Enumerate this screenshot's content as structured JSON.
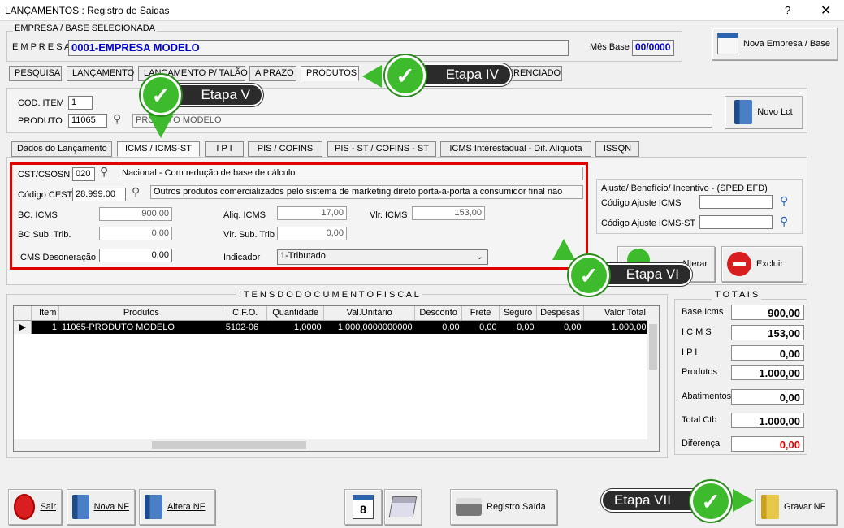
{
  "window": {
    "title": "LANÇAMENTOS : Registro de Saidas",
    "help": "?",
    "close": "✕"
  },
  "empresa": {
    "section_label": "EMPRESA / BASE SELECIONADA",
    "label": "E M P R E S A",
    "value": "0001-EMPRESA MODELO",
    "mes_base_label": "Mês Base",
    "mes_base_value": "00/0000",
    "nova_button": "Nova Empresa / Base"
  },
  "top_tabs": [
    "PESQUISA",
    "LANÇAMENTO",
    "LANÇAMENTO P/ TALÃO",
    "A PRAZO",
    "PRODUTOS",
    "DIFERENCIADO"
  ],
  "produto": {
    "cod_item_label": "COD. ITEM",
    "cod_item_value": "1",
    "produto_label": "PRODUTO",
    "produto_code": "11065",
    "produto_desc": "PRODUTO MODELO",
    "novo_lct": "Novo Lct"
  },
  "sub_tabs": [
    "Dados do Lançamento",
    "ICMS  /  ICMS-ST",
    "I P I",
    "PIS  /  COFINS",
    "PIS - ST  /  COFINS - ST",
    "ICMS Interestadual - Dif. Alíquota",
    "ISSQN"
  ],
  "icms": {
    "cst_label": "CST/CSOSN",
    "cst_value": "020",
    "cst_desc": "Nacional - Com redução de base de cálculo",
    "cest_label": "Código CEST",
    "cest_value": "28.999.00",
    "cest_desc": "Outros produtos comercializados pelo sistema de marketing direto porta-a-porta a consumidor final não",
    "bc_label": "BC.   ICMS",
    "bc_value": "900,00",
    "aliq_label": "Aliq.  ICMS",
    "aliq_value": "17,00",
    "vlr_label": "Vlr.  ICMS",
    "vlr_value": "153,00",
    "bcst_label": "BC Sub. Trib.",
    "bcst_value": "0,00",
    "vlrst_label": "Vlr. Sub. Trib",
    "vlrst_value": "0,00",
    "deson_label": "ICMS Desoneração",
    "deson_value": "0,00",
    "indicador_label": "Indicador",
    "indicador_value": "1-Tributado"
  },
  "ajuste": {
    "title": "Ajuste/ Benefício/ Incentivo - (SPED EFD)",
    "icms_label": "Código Ajuste ICMS",
    "icmsst_label": "Código Ajuste ICMS-ST"
  },
  "actions": {
    "alterar": "Alterar",
    "excluir": "Excluir"
  },
  "items": {
    "title": "I T E N S      D O      D O C U M E N T O      F I S C A L",
    "columns": [
      "Item",
      "Produtos",
      "C.F.O.",
      "Quantidade",
      "Val.Unitário",
      "Desconto",
      "Frete",
      "Seguro",
      "Despesas",
      "Valor Total"
    ],
    "rows": [
      [
        "1",
        "11065-PRODUTO MODELO",
        "5102-06",
        "1,0000",
        "1.000,0000000000",
        "0,00",
        "0,00",
        "0,00",
        "0,00",
        "1.000,00"
      ]
    ]
  },
  "totais": {
    "title": "T O T A I S",
    "rows": [
      {
        "label": "Base Icms",
        "value": "900,00"
      },
      {
        "label": "I C M S",
        "value": "153,00"
      },
      {
        "label": "I P I",
        "value": "0,00"
      },
      {
        "label": "Produtos",
        "value": "1.000,00"
      },
      {
        "label": "Abatimentos",
        "value": "0,00"
      },
      {
        "label": "Total Ctb",
        "value": "1.000,00"
      },
      {
        "label": "Diferença",
        "value": "0,00"
      }
    ]
  },
  "bottom": {
    "sair": "Sair",
    "nova_nf": "Nova NF",
    "altera_nf": "Altera NF",
    "calendar_day": "8",
    "registro_saida": "Registro Saída",
    "gravar_nf": "Gravar NF"
  },
  "callouts": {
    "iv": "Etapa IV",
    "v": "Etapa V",
    "vi": "Etapa VI",
    "vii": "Etapa VII"
  },
  "colors": {
    "highlight": "#e00000",
    "check": "#3dbb2c",
    "empresa_text": "#0000cc",
    "diferenca": "#e00000"
  }
}
